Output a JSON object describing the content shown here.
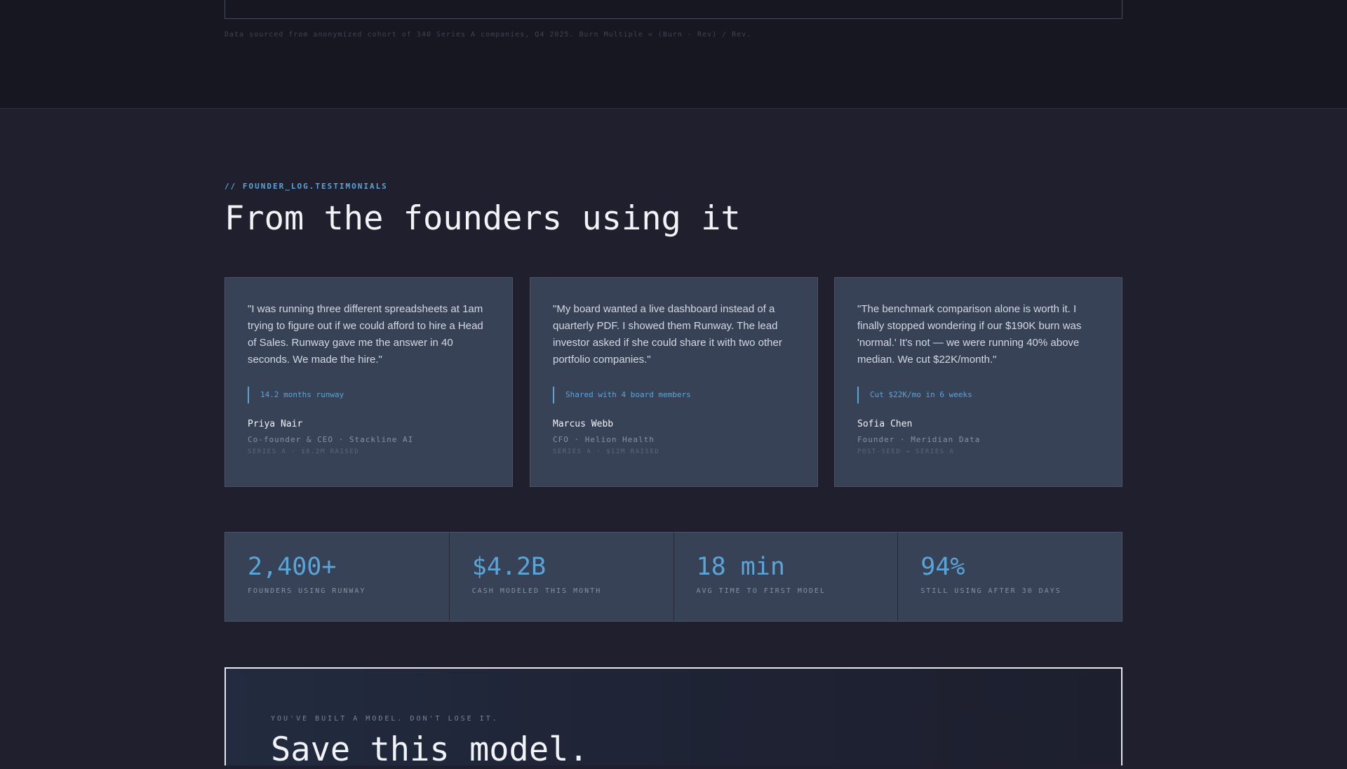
{
  "benchmark": {
    "footnote": "Data sourced from anonymized cohort of 340 Series A companies, Q4 2025. Burn Multiple = (Burn - Rev) / Rev."
  },
  "testimonials": {
    "eyebrow": "// FOUNDER_LOG.TESTIMONIALS",
    "title": "From the founders using it",
    "items": [
      {
        "quote": "\"I was running three different spreadsheets at 1am trying to figure out if we could afford to hire a Head of Sales. Runway gave me the answer in 40 seconds. We made the hire.\"",
        "metric": "14.2 months runway",
        "name": "Priya Nair",
        "role": "Co-founder & CEO · Stackline AI",
        "round": "SERIES A · $8.2M RAISED"
      },
      {
        "quote": "\"My board wanted a live dashboard instead of a quarterly PDF. I showed them Runway. The lead investor asked if she could share it with two other portfolio companies.\"",
        "metric": "Shared with 4 board members",
        "name": "Marcus Webb",
        "role": "CFO · Helion Health",
        "round": "SERIES A · $12M RAISED"
      },
      {
        "quote": "\"The benchmark comparison alone is worth it. I finally stopped wondering if our $190K burn was 'normal.' It's not — we were running 40% above median. We cut $22K/month.\"",
        "metric": "Cut $22K/mo in 6 weeks",
        "name": "Sofia Chen",
        "role": "Founder · Meridian Data",
        "round": "POST-SEED → SERIES A"
      }
    ]
  },
  "stats": [
    {
      "value": "2,400+",
      "label": "FOUNDERS USING RUNWAY"
    },
    {
      "value": "$4.2B",
      "label": "CASH MODELED THIS MONTH"
    },
    {
      "value": "18 min",
      "label": "AVG TIME TO FIRST MODEL"
    },
    {
      "value": "94%",
      "label": "STILL USING AFTER 30 DAYS"
    }
  ],
  "cta": {
    "eyebrow": "YOU'VE BUILT A MODEL. DON'T LOSE IT.",
    "title": "Save this model."
  }
}
